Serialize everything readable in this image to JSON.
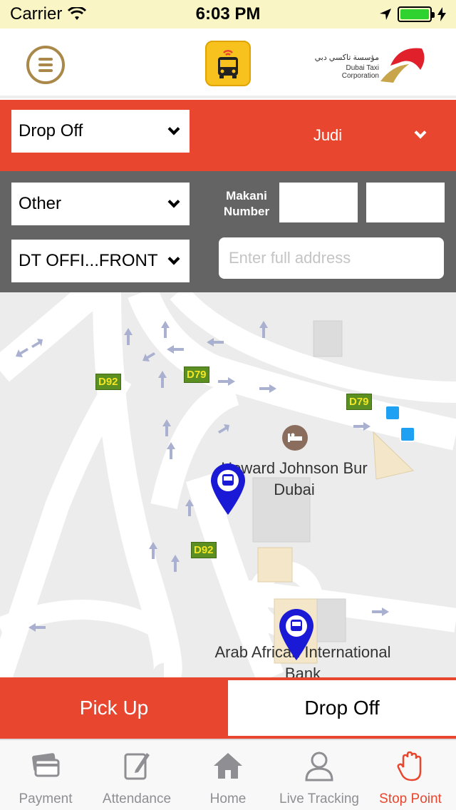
{
  "status_bar": {
    "carrier": "Carrier",
    "time": "6:03 PM"
  },
  "header": {
    "menu_icon": "hamburger-menu-icon",
    "app_icon": "school-bus-icon",
    "brand_logo_ar": "مؤسسة تاكسي دبي",
    "brand_logo_en": "Dubai Taxi Corporation"
  },
  "filters": {
    "trip_type": "Drop Off",
    "student": "Judi",
    "location_type": "Other",
    "stop": "DT OFFI...FRONT",
    "makani_label": "Makani Number",
    "makani_value_1": "",
    "makani_value_2": "",
    "address_placeholder": "Enter full address"
  },
  "map": {
    "road_labels": [
      "D92",
      "D79",
      "D79",
      "D92"
    ],
    "poi_hotel": "Howard Johnson Bur Dubai",
    "poi_bank": "Arab African International Bank"
  },
  "toggle": {
    "pickup_label": "Pick Up",
    "dropoff_label": "Drop Off",
    "selected": "Drop Off"
  },
  "tabs": [
    {
      "label": "Payment",
      "icon": "credit-card-icon"
    },
    {
      "label": "Attendance",
      "icon": "edit-note-icon"
    },
    {
      "label": "Home",
      "icon": "home-icon"
    },
    {
      "label": "Live Tracking",
      "icon": "person-icon"
    },
    {
      "label": "Stop Point",
      "icon": "hand-stop-icon"
    }
  ],
  "colors": {
    "accent_red": "#e8462e",
    "gray_bar": "#646464",
    "menu_gold": "#a9884a",
    "pin_blue": "#1a1ad6"
  }
}
